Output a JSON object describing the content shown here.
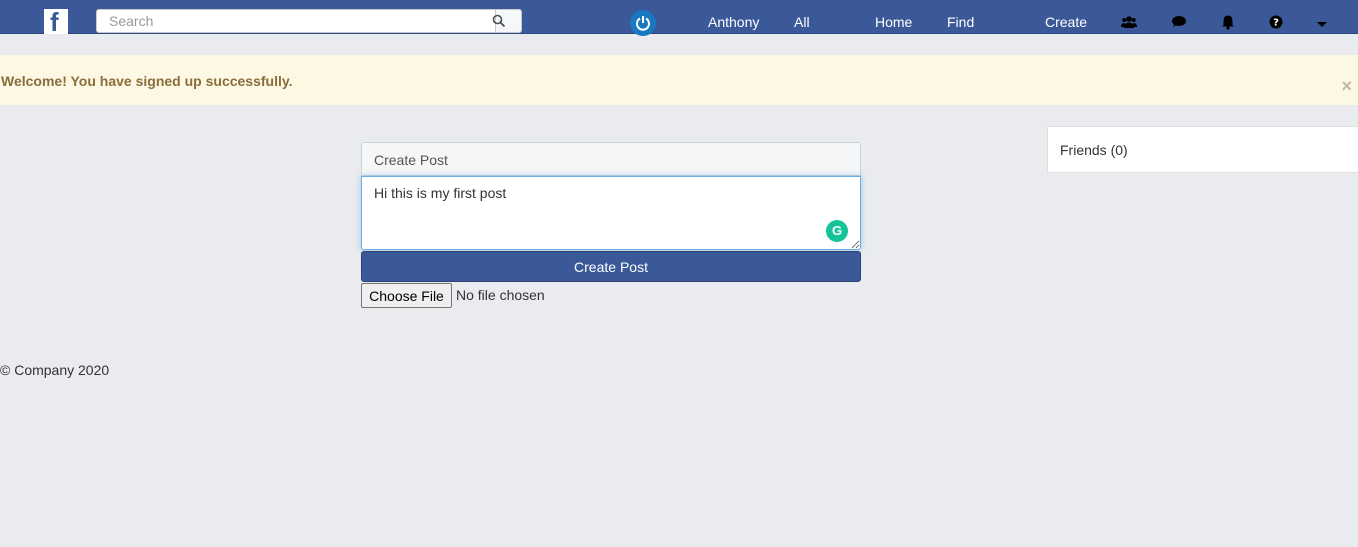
{
  "navbar": {
    "logo": "f",
    "search": {
      "placeholder": "Search",
      "value": ""
    },
    "links": {
      "user": "Anthony",
      "all": "All",
      "home": "Home",
      "find": "Find",
      "create": "Create"
    },
    "icons": [
      "power-icon",
      "friends-icon",
      "messages-icon",
      "notifications-icon",
      "help-icon",
      "dropdown-caret-icon"
    ],
    "colors": {
      "bar": "#3b5998",
      "power": "#1a78c2"
    }
  },
  "alert": {
    "message": "Welcome! You have signed up successfully.",
    "close": "×"
  },
  "composer": {
    "header": "Create Post",
    "text": "Hi this is my first post",
    "grammarly": "G",
    "submit_label": "Create Post",
    "file_button": "Choose File",
    "file_status": "No file chosen"
  },
  "sidebar": {
    "friends": "Friends (0)"
  },
  "footer": {
    "copyright": "© Company 2020"
  }
}
